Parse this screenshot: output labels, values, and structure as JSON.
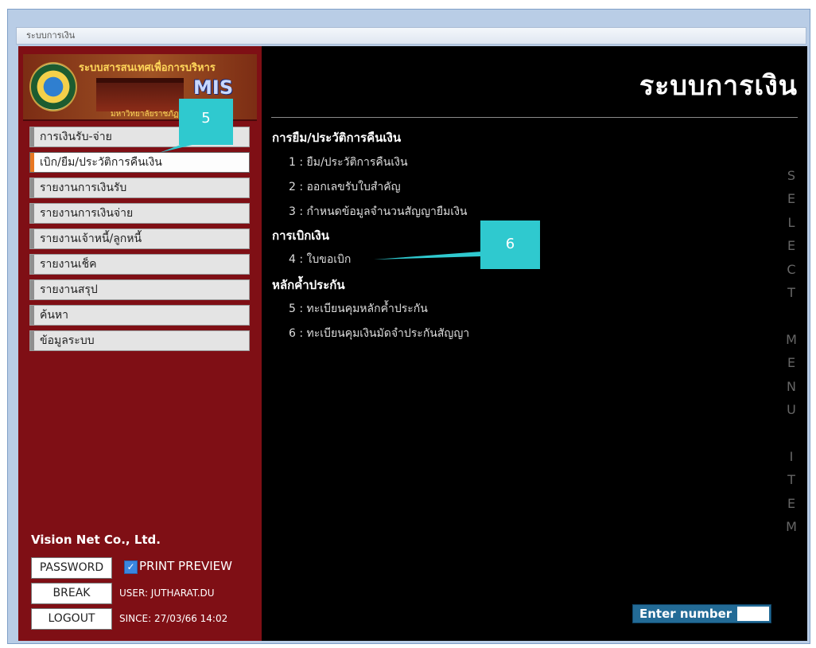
{
  "window": {
    "title": "ระบบการเงิน"
  },
  "logo": {
    "title": "ระบบสารสนเทศเพื่อการบริหาร",
    "acronym": "MIS",
    "subtitle": "มหาวิทยาลัยราชภัฏยะลา"
  },
  "menu": {
    "items": [
      {
        "label": "การเงินรับ-จ่าย"
      },
      {
        "label": "เบิก/ยืม/ประวัติการคืนเงิน"
      },
      {
        "label": "รายงานการเงินรับ"
      },
      {
        "label": "รายงานการเงินจ่าย"
      },
      {
        "label": "รายงานเจ้าหนี้/ลูกหนี้"
      },
      {
        "label": "รายงานเช็ค"
      },
      {
        "label": "รายงานสรุป"
      },
      {
        "label": "ค้นหา"
      },
      {
        "label": "ข้อมูลระบบ"
      }
    ]
  },
  "footer": {
    "company": "Vision Net Co., Ltd.",
    "password_label": "PASSWORD",
    "print_preview_label": "PRINT PREVIEW",
    "break_label": "BREAK",
    "logout_label": "LOGOUT",
    "user_text": "USER: JUTHARAT.DU",
    "since_text": "SINCE: 27/03/66 14:02"
  },
  "main": {
    "heading": "ระบบการเงิน",
    "sections": [
      {
        "title": "การยืม/ประวัติการคืนเงิน",
        "items": [
          "1 : ยืม/ประวัติการคืนเงิน",
          "2 : ออกเลขรับใบสำคัญ",
          "3 : กำหนดข้อมูลจำนวนสัญญายืมเงิน"
        ]
      },
      {
        "title": "การเบิกเงิน",
        "items": [
          "4 : ใบขอเบิก"
        ]
      },
      {
        "title": "หลักค้ำประกัน",
        "items": [
          "5 : ทะเบียนคุมหลักค้ำประกัน",
          "6 : ทะเบียนคุมเงินมัดจำประกันสัญญา"
        ]
      }
    ],
    "vertical_text": [
      "S",
      "E",
      "L",
      "E",
      "C",
      "T",
      "",
      "M",
      "E",
      "N",
      "U",
      "",
      "I",
      "T",
      "E",
      "M"
    ],
    "enter_label": "Enter number",
    "enter_value": ""
  },
  "callouts": [
    "5",
    "6"
  ],
  "colors": {
    "sidebar": "#7f0f15",
    "main": "#000000",
    "accent": "#e87722",
    "callout": "#2fc9cf",
    "enter_box": "#236b96"
  }
}
